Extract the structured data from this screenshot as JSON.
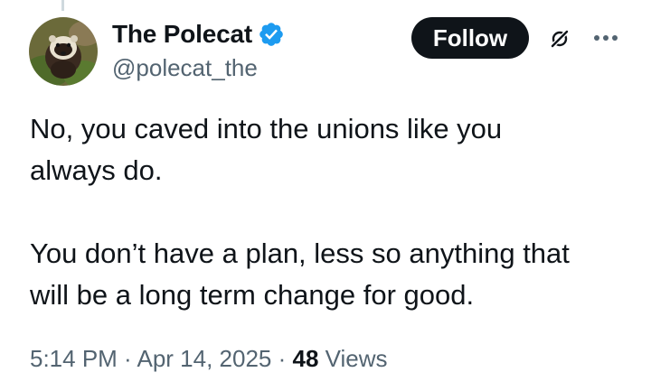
{
  "author": {
    "display_name": "The Polecat",
    "handle": "@polecat_the",
    "verified": true
  },
  "actions": {
    "follow_label": "Follow",
    "grok_icon": "grok-icon",
    "more_icon": "more-options-icon"
  },
  "tweet": {
    "paragraph1_line1": "No, you caved into the unions like you",
    "paragraph1_line2": "always do.",
    "paragraph2_line1": "You don’t have a plan, less so anything that",
    "paragraph2_line2": "will be a long term change for good."
  },
  "meta": {
    "time": "5:14 PM",
    "separator1": " · ",
    "date": "Apr 14, 2025",
    "separator2": " · ",
    "views_count": "48",
    "views_label": " Views"
  },
  "colors": {
    "text_primary": "#0f1419",
    "text_secondary": "#536471",
    "verified_blue": "#1d9bf0",
    "button_bg": "#0f1419"
  }
}
